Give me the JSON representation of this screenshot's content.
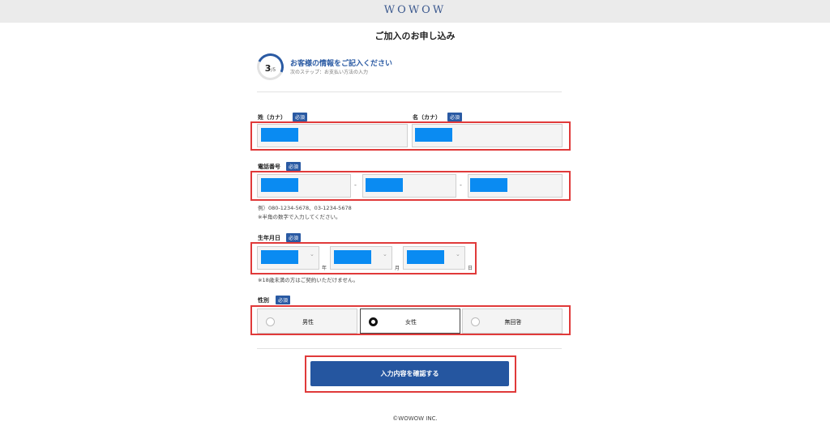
{
  "header": {
    "logo": "WOWOW"
  },
  "page": {
    "title": "ご加入のお申し込み"
  },
  "step": {
    "current": "3",
    "total": "/5",
    "title": "お客様の情報をご記入ください",
    "next": "次のステップ：お支払い方法の入力"
  },
  "badges": {
    "required": "必須"
  },
  "name": {
    "last_label": "姓（カナ）",
    "first_label": "名（カナ）"
  },
  "phone": {
    "label": "電話番号",
    "sep": "-",
    "example": "例）080-1234-5678、03-1234-5678",
    "note": "※半角の数字で入力してください。"
  },
  "birth": {
    "label": "生年月日",
    "year_unit": "年",
    "month_unit": "月",
    "day_unit": "日",
    "note": "※18歳未満の方はご契約いただけません。",
    "chevron": "⌄"
  },
  "gender": {
    "label": "性別",
    "options": [
      "男性",
      "女性",
      "無回答"
    ],
    "selected": "女性"
  },
  "submit": {
    "label": "入力内容を確認する"
  },
  "footer": {
    "copyright": "©WOWOW INC."
  },
  "colors": {
    "accent": "#2a5aa3",
    "button": "#2556a0",
    "highlight": "#e03a3a",
    "masked": "#0a8bf2"
  }
}
